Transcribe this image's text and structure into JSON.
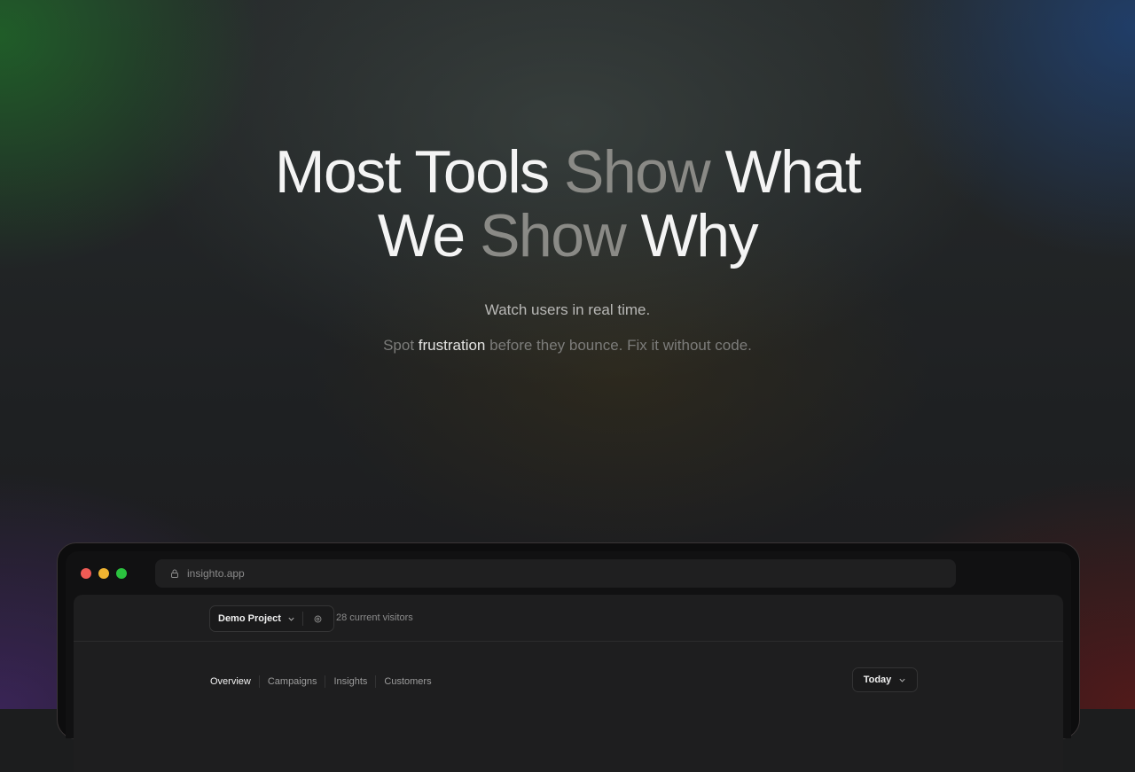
{
  "hero": {
    "line1": {
      "a": "Most Tools ",
      "b": "Show",
      "c": " What"
    },
    "line2": {
      "a": "We ",
      "b": "Show",
      "c": " Why"
    },
    "subtitle": "Watch users in real time.",
    "tagline": {
      "a": "Spot ",
      "highlight": "frustration",
      "b": " before they bounce. Fix it without code."
    }
  },
  "browser": {
    "url": "insighto.app",
    "controls": [
      "close",
      "minimize",
      "maximize"
    ]
  },
  "app": {
    "project_name": "Demo Project",
    "visitors": "28 current visitors",
    "tabs": [
      {
        "label": "Overview",
        "active": true
      },
      {
        "label": "Campaigns"
      },
      {
        "label": "Insights"
      },
      {
        "label": "Customers"
      }
    ],
    "date_range": "Today"
  },
  "colors": {
    "muted_text": "#8a8a86",
    "highlight_text": "#e4e4e2",
    "close": "#ef5b55",
    "minimize": "#f0b431",
    "maximize": "#2bc23f"
  }
}
